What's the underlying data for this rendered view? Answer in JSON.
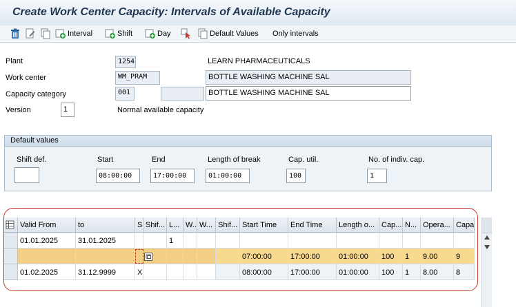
{
  "window": {
    "title": "Create Work Center Capacity: Intervals of Available Capacity"
  },
  "toolbar": {
    "interval_label": "Interval",
    "shift_label": "Shift",
    "day_label": "Day",
    "default_values_label": "Default Values",
    "only_intervals_label": "Only intervals"
  },
  "header": {
    "plant_label": "Plant",
    "plant_value": "1254",
    "plant_desc": "LEARN PHARMACEUTICALS",
    "work_center_label": "Work center",
    "work_center_value": "WM_PRAM",
    "work_center_desc": "BOTTLE WASHING MACHINE SAL",
    "capacity_category_label": "Capacity category",
    "capacity_category_value": "001",
    "capacity_desc": "BOTTLE WASHING MACHINE SAL",
    "version_label": "Version",
    "version_value": "1",
    "version_desc": "Normal available capacity"
  },
  "defaults": {
    "title": "Default values",
    "shift_def_label": "Shift def.",
    "shift_def_value": "",
    "start_label": "Start",
    "start_value": "08:00:00",
    "end_label": "End",
    "end_value": "17:00:00",
    "break_label": "Length of break",
    "break_value": "01:00:00",
    "util_label": "Cap. util.",
    "util_value": "100",
    "indiv_label": "No. of indiv. cap.",
    "indiv_value": "1"
  },
  "table": {
    "columns": [
      "Valid From",
      "to",
      "S",
      "Shif...",
      "L...",
      "W...",
      "W...",
      "Shif...",
      "Start Time",
      "End Time",
      "Length o...",
      "Cap...",
      "N...",
      "Opera...",
      "Capa..."
    ],
    "rows": [
      [
        "01.01.2025",
        "31.01.2025",
        "",
        "",
        "1",
        "",
        "",
        "",
        "",
        "",
        "",
        "",
        "",
        "",
        ""
      ],
      [
        "",
        "",
        "",
        "",
        "",
        "",
        "",
        "",
        "07:00:00",
        "17:00:00",
        "01:00:00",
        "100",
        "1",
        "9.00",
        "9"
      ],
      [
        "01.02.2025",
        "31.12.9999",
        "X",
        "",
        "",
        "",
        "",
        "",
        "08:00:00",
        "17:00:00",
        "01:00:00",
        "100",
        "1",
        "8.00",
        "8"
      ]
    ]
  },
  "colors": {
    "accent": "#1f3550",
    "highlight": "#f7d98f",
    "outline": "#c0392b"
  }
}
